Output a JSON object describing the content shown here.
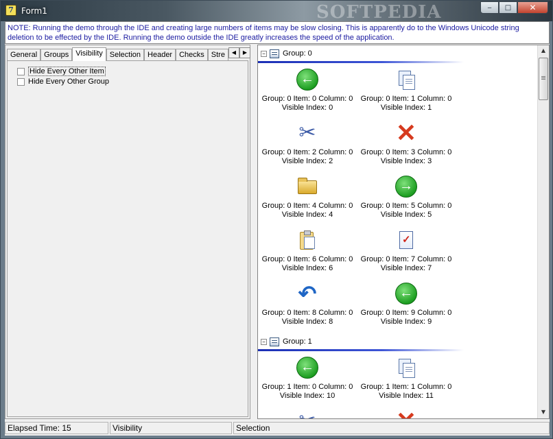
{
  "window": {
    "title": "Form1",
    "app_icon_glyph": "7",
    "watermark": "SOFTPEDIA",
    "buttons": {
      "minimize": "‒",
      "maximize": "□",
      "close": "✕"
    }
  },
  "note": "NOTE:  Running the demo through the IDE and creating large numbers of items may be slow closing.  This is apparently do to the Windows Unicode string deletion to be effected by the IDE.  Running the demo outside the IDE greatly increases the speed of the application.",
  "tabs": [
    {
      "label": "General"
    },
    {
      "label": "Groups"
    },
    {
      "label": "Visibility",
      "active": true
    },
    {
      "label": "Selection"
    },
    {
      "label": "Header"
    },
    {
      "label": "Checks"
    },
    {
      "label": "Stre"
    }
  ],
  "tab_scroll": {
    "left": "◀",
    "right": "▶"
  },
  "visibility": {
    "hide_every_other_item": {
      "label": "Hide Every Other Item",
      "checked": false
    },
    "hide_every_other_group": {
      "label": "Hide Every Other Group",
      "checked": false
    }
  },
  "listview": {
    "groups": [
      {
        "expander": "−",
        "label": "Group: 0",
        "items": [
          {
            "icon": "back-arrow-icon",
            "line1": "Group: 0 Item: 0 Column: 0",
            "line2": "Visible Index: 0"
          },
          {
            "icon": "copy-icon",
            "line1": "Group: 0 Item: 1 Column: 0",
            "line2": "Visible Index: 1"
          },
          {
            "icon": "scissors-icon",
            "line1": "Group: 0 Item: 2 Column: 0",
            "line2": "Visible Index: 2"
          },
          {
            "icon": "delete-x-icon",
            "line1": "Group: 0 Item: 3 Column: 0",
            "line2": "Visible Index: 3"
          },
          {
            "icon": "folder-icon",
            "line1": "Group: 0 Item: 4 Column: 0",
            "line2": "Visible Index: 4"
          },
          {
            "icon": "forward-arrow-icon",
            "line1": "Group: 0 Item: 5 Column: 0",
            "line2": "Visible Index: 5"
          },
          {
            "icon": "paste-icon",
            "line1": "Group: 0 Item: 6 Column: 0",
            "line2": "Visible Index: 6"
          },
          {
            "icon": "check-document-icon",
            "line1": "Group: 0 Item: 7 Column: 0",
            "line2": "Visible Index: 7"
          },
          {
            "icon": "undo-icon",
            "line1": "Group: 0 Item: 8 Column: 0",
            "line2": "Visible Index: 8"
          },
          {
            "icon": "back-arrow-icon",
            "line1": "Group: 0 Item: 9 Column: 0",
            "line2": "Visible Index: 9"
          }
        ]
      },
      {
        "expander": "−",
        "label": "Group: 1",
        "items": [
          {
            "icon": "back-arrow-icon",
            "line1": "Group: 1 Item: 0 Column: 0",
            "line2": "Visible Index: 10"
          },
          {
            "icon": "copy-icon",
            "line1": "Group: 1 Item: 1 Column: 0",
            "line2": "Visible Index: 11"
          }
        ]
      }
    ],
    "scrollbar": {
      "up": "▲",
      "down": "▼"
    }
  },
  "statusbar": {
    "elapsed": "Elapsed Time: 15",
    "tab": "Visibility",
    "mode": "Selection"
  }
}
